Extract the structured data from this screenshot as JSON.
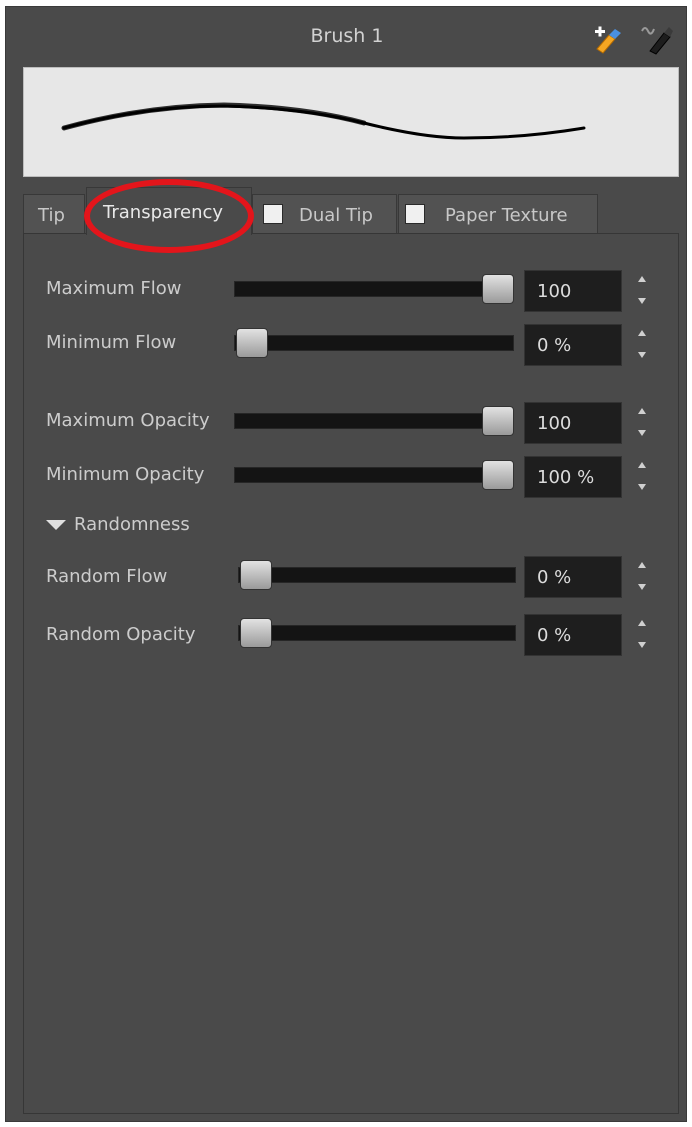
{
  "panel": {
    "title": "Brush 1",
    "new_brush_icon": "brush-plus-icon",
    "rename_brush_icon": "brush-rename-icon"
  },
  "tabs": [
    {
      "label": "Tip",
      "active": false,
      "checkbox": false
    },
    {
      "label": "Transparency",
      "active": true,
      "checkbox": false
    },
    {
      "label": "Dual Tip",
      "active": false,
      "checkbox": true,
      "checked": false
    },
    {
      "label": "Paper Texture",
      "active": false,
      "checkbox": true,
      "checked": false
    }
  ],
  "flow": {
    "maximum": {
      "label": "Maximum Flow",
      "value": "100",
      "level": 1.0
    },
    "minimum": {
      "label": "Minimum Flow",
      "value": "0 %",
      "level": 0.0
    }
  },
  "opacity": {
    "maximum": {
      "label": "Maximum Opacity",
      "value": "100",
      "level": 1.0
    },
    "minimum": {
      "label": "Minimum Opacity",
      "value": "100 %",
      "level": 1.0
    }
  },
  "randomness": {
    "header": "Randomness",
    "expanded": true,
    "flow": {
      "label": "Random Flow",
      "value": "0 %",
      "level": 0.0
    },
    "opacity": {
      "label": "Random Opacity",
      "value": "0 %",
      "level": 0.0
    }
  },
  "colors": {
    "panel_bg": "#4a4a4a",
    "highlight": "#e3151b"
  }
}
